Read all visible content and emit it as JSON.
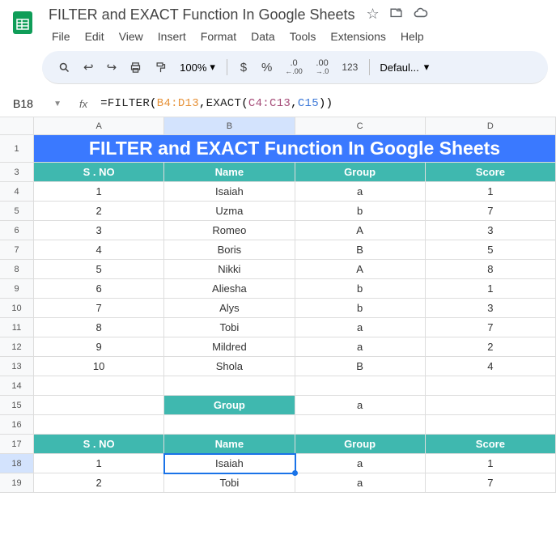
{
  "doc_title": "FILTER and EXACT Function In Google Sheets",
  "menu": {
    "file": "File",
    "edit": "Edit",
    "view": "View",
    "insert": "Insert",
    "format": "Format",
    "data": "Data",
    "tools": "Tools",
    "extensions": "Extensions",
    "help": "Help"
  },
  "toolbar": {
    "zoom": "100%",
    "currency": "$",
    "percent": "%",
    "dec_dec": ".0",
    "dec_inc": ".00",
    "num123": "123",
    "font": "Defaul..."
  },
  "namebox": "B18",
  "formula": {
    "eq": "=",
    "fn1": "FILTER",
    "open": "(",
    "r1": "B4:D13",
    "c1": ",",
    "fn2": "EXACT",
    "open2": "(",
    "r2": "C4:C13",
    "c2": ",",
    "r3": "C15",
    "close": "))"
  },
  "columns": [
    "A",
    "B",
    "C",
    "D"
  ],
  "rows_labels": [
    "1",
    "3",
    "4",
    "5",
    "6",
    "7",
    "8",
    "9",
    "10",
    "11",
    "12",
    "13",
    "14",
    "15",
    "16",
    "17",
    "18",
    "19"
  ],
  "banner_text": "FILTER and EXACT Function In Google Sheets",
  "table_headers": {
    "sno": "S . NO",
    "name": "Name",
    "group": "Group",
    "score": "Score"
  },
  "data_rows": [
    {
      "sno": "1",
      "name": "Isaiah",
      "group": "a",
      "score": "1"
    },
    {
      "sno": "2",
      "name": "Uzma",
      "group": "b",
      "score": "7"
    },
    {
      "sno": "3",
      "name": "Romeo",
      "group": "A",
      "score": "3"
    },
    {
      "sno": "4",
      "name": "Boris",
      "group": "B",
      "score": "5"
    },
    {
      "sno": "5",
      "name": "Nikki",
      "group": "A",
      "score": "8"
    },
    {
      "sno": "6",
      "name": "Aliesha",
      "group": "b",
      "score": "1"
    },
    {
      "sno": "7",
      "name": "Alys",
      "group": "b",
      "score": "3"
    },
    {
      "sno": "8",
      "name": "Tobi",
      "group": "a",
      "score": "7"
    },
    {
      "sno": "9",
      "name": "Mildred",
      "group": "a",
      "score": "2"
    },
    {
      "sno": "10",
      "name": "Shola",
      "group": "B",
      "score": "4"
    }
  ],
  "filter_input": {
    "label": "Group",
    "value": "a"
  },
  "result_rows": [
    {
      "sno": "1",
      "name": "Isaiah",
      "group": "a",
      "score": "1"
    },
    {
      "sno": "2",
      "name": "Tobi",
      "group": "a",
      "score": "7"
    }
  ]
}
